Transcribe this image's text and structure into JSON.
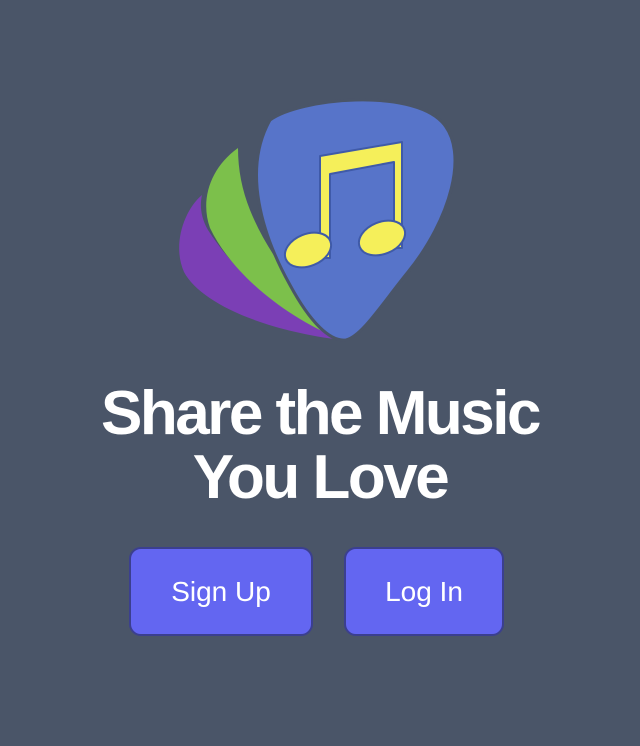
{
  "logo": {
    "icon": "music-note-guitar-pick-icon",
    "colors": {
      "purple": "#7b3fb5",
      "green": "#7cc04b",
      "blue": "#5774c9",
      "yellow": "#f5ef5a"
    }
  },
  "headline": {
    "line1": "Share the Music",
    "line2": "You Love"
  },
  "buttons": {
    "signup_label": "Sign Up",
    "login_label": "Log In",
    "color": "#6366f1"
  },
  "background": "#4a5568"
}
